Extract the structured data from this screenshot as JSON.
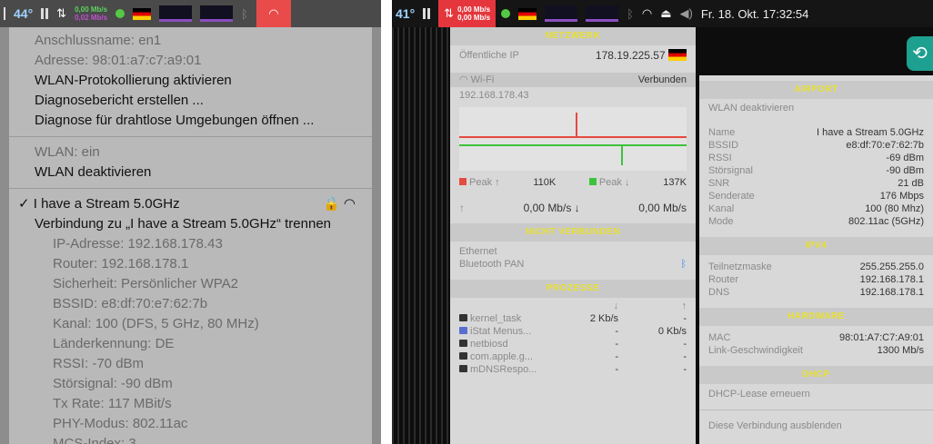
{
  "left": {
    "menubar": {
      "temp": "44°",
      "rate_up": "0,00 Mb/s",
      "rate_down": "0,02 Mb/s"
    },
    "menu": {
      "anschlussname": "Anschlussname: en1",
      "adresse": "Adresse: 98:01:a7:c7:a9:01",
      "wlan_protokoll": "WLAN-Protokollierung aktivieren",
      "diagnosebericht": "Diagnosebericht erstellen ...",
      "diagnose_umgebungen": "Diagnose für drahtlose Umgebungen öffnen ...",
      "wlan_status": "WLAN: ein",
      "wlan_deaktivieren": "WLAN deaktivieren",
      "network_name": "✓ I have a Stream 5.0GHz",
      "trennen": "Verbindung zu „I have a Stream 5.0GHz“ trennen",
      "details": [
        "IP-Adresse: 192.168.178.43",
        "Router: 192.168.178.1",
        "Sicherheit: Persönlicher WPA2",
        "BSSID: e8:df:70:e7:62:7b",
        "Kanal: 100 (DFS, 5 GHz, 80 MHz)",
        "Länderkennung: DE",
        "RSSI: -70 dBm",
        "Störsignal: -90 dBm",
        "Tx Rate: 117 MBit/s",
        "PHY-Modus: 802.11ac",
        "MCS-Index: 3"
      ]
    }
  },
  "right": {
    "menubar": {
      "temp": "41°",
      "rate_up": "0,00 Mb/s",
      "rate_down": "0,00 Mb/s",
      "datetime": "Fr. 18. Okt.  17:32:54"
    },
    "netzwerk": {
      "header": "NETZWERK",
      "public_ip_label": "Öffentliche IP",
      "public_ip": "178.19.225.57",
      "wifi_label": "Wi-Fi",
      "wifi_status": "Verbunden",
      "local_ip": "192.168.178.43",
      "peak_up_label": "Peak ↑",
      "peak_up": "110K",
      "peak_down_label": "Peak ↓",
      "peak_down": "137K",
      "up_arrow": "↑",
      "rate_up": "0,00 Mb/s ↓",
      "rate_down": "0,00 Mb/s"
    },
    "nicht_verbunden": {
      "header": "NICHT VERBUNDEN",
      "ethernet": "Ethernet",
      "bluetooth": "Bluetooth PAN"
    },
    "prozesse": {
      "header": "PROZESSE",
      "col_down": "↓",
      "col_up": "↑",
      "rows": [
        {
          "name": "kernel_task",
          "down": "2 Kb/s",
          "up": "-"
        },
        {
          "name": "iStat Menus...",
          "down": "-",
          "up": "0 Kb/s"
        },
        {
          "name": "netbiosd",
          "down": "-",
          "up": "-"
        },
        {
          "name": "com.apple.g...",
          "down": "-",
          "up": "-"
        },
        {
          "name": "mDNSRespo...",
          "down": "-",
          "up": "-"
        }
      ]
    },
    "airport": {
      "header": "AIRPORT",
      "deactivate": "WLAN deaktivieren",
      "rows": [
        {
          "label": "Name",
          "value": "I have a Stream 5.0GHz"
        },
        {
          "label": "BSSID",
          "value": "e8:df:70:e7:62:7b"
        },
        {
          "label": "RSSI",
          "value": "-69 dBm"
        },
        {
          "label": "Störsignal",
          "value": "-90 dBm"
        },
        {
          "label": "SNR",
          "value": "21 dB"
        },
        {
          "label": "Senderate",
          "value": "176 Mbps"
        },
        {
          "label": "Kanal",
          "value": "100 (80 Mhz)"
        },
        {
          "label": "Mode",
          "value": "802.11ac (5GHz)"
        }
      ]
    },
    "ipv4": {
      "header": "IPV4",
      "rows": [
        {
          "label": "Teilnetzmaske",
          "value": "255.255.255.0"
        },
        {
          "label": "Router",
          "value": "192.168.178.1"
        },
        {
          "label": "DNS",
          "value": "192.168.178.1"
        }
      ]
    },
    "hardware": {
      "header": "HARDWARE",
      "rows": [
        {
          "label": "MAC",
          "value": "98:01:A7:C7:A9:01"
        },
        {
          "label": "Link-Geschwindigkeit",
          "value": "1300 Mb/s"
        }
      ]
    },
    "dhcp": {
      "header": "DHCP",
      "renew": "DHCP-Lease erneuern",
      "hide": "Diese Verbindung ausblenden"
    }
  }
}
